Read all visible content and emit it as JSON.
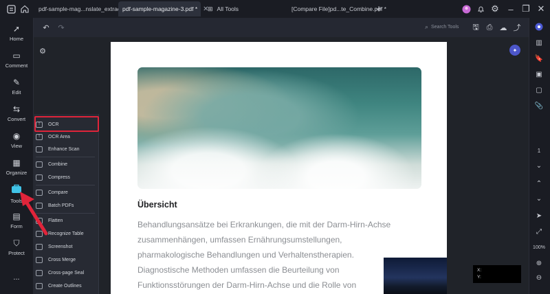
{
  "titlebar": {
    "tabs": [
      {
        "label": "pdf-sample-mag...nslate_extract.pdf",
        "active": false
      },
      {
        "label": "pdf-sample-magazine-3.pdf *",
        "active": true
      },
      {
        "label": "All Tools",
        "active": false
      },
      {
        "label": "[Compare  File]pd...te_Combine.pdf *",
        "active": false
      }
    ],
    "new_tab_label": "+"
  },
  "rail": {
    "items": [
      {
        "label": "Home",
        "icon": "home-icon"
      },
      {
        "label": "Comment",
        "icon": "comment-icon"
      },
      {
        "label": "Edit",
        "icon": "edit-icon"
      },
      {
        "label": "Convert",
        "icon": "convert-icon"
      },
      {
        "label": "View",
        "icon": "eye-icon"
      },
      {
        "label": "Organize",
        "icon": "organize-icon"
      },
      {
        "label": "Tools",
        "icon": "tools-icon"
      },
      {
        "label": "Form",
        "icon": "form-icon"
      },
      {
        "label": "Protect",
        "icon": "shield-icon"
      }
    ],
    "more_label": "..."
  },
  "toolbar": {
    "search_placeholder": "Search Tools"
  },
  "menu": {
    "items": [
      {
        "label": "OCR",
        "group": 1
      },
      {
        "label": "OCR Area",
        "group": 1
      },
      {
        "label": "Enhance Scan",
        "group": 1
      },
      {
        "label": "Combine",
        "group": 2
      },
      {
        "label": "Compress",
        "group": 2
      },
      {
        "label": "Compare",
        "group": 3
      },
      {
        "label": "Batch PDFs",
        "group": 3
      },
      {
        "label": "Flatten",
        "group": 4
      },
      {
        "label": "Recognize Table",
        "group": 4
      },
      {
        "label": "Screenshot",
        "group": 4
      },
      {
        "label": "Cross Merge",
        "group": 4
      },
      {
        "label": "Cross-page Seal",
        "group": 4
      },
      {
        "label": "Create Outlines",
        "group": 4
      }
    ],
    "highlight_color": "#e0243a"
  },
  "document": {
    "heading": "Übersicht",
    "lines": [
      "Behandlungsansätze bei Erkrankungen, die mit der Darm-Hirn-Achse",
      "zusammenhängen, umfassen Ernährungsumstellungen,",
      "pharmakologische Behandlungen und Verhaltenstherapien.",
      "Diagnostische Methoden umfassen die Beurteilung von",
      "Funktionsstörungen der Darm-Hirn-Achse und die Rolle von"
    ]
  },
  "right_rail": {
    "page_number": "1",
    "zoom": "100%"
  },
  "coords": {
    "x_label": "X:",
    "y_label": "Y:"
  },
  "colors": {
    "accent": "#e0243a",
    "background": "#1f222b"
  }
}
